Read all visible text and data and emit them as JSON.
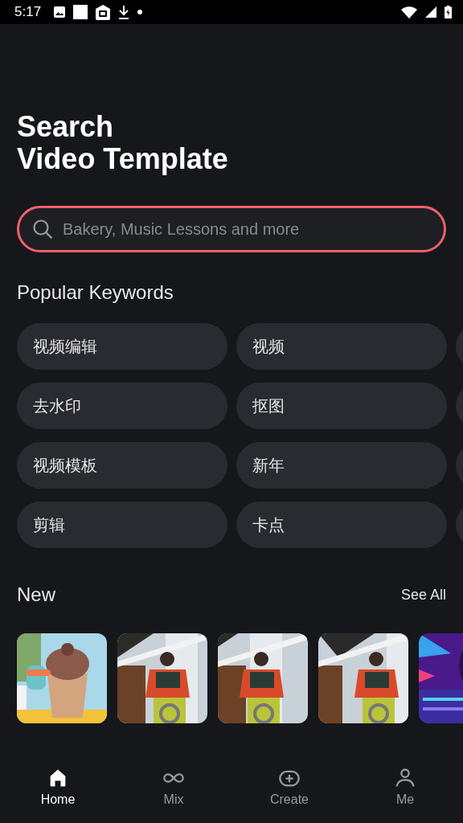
{
  "status_bar": {
    "time": "5:17"
  },
  "header": {
    "title_lines": [
      "Search",
      "Video Template"
    ]
  },
  "search": {
    "placeholder": "Bakery, Music Lessons and more"
  },
  "popular": {
    "title": "Popular Keywords",
    "keywords": [
      {
        "label": "视频编辑"
      },
      {
        "label": "视频"
      },
      {
        "label": "去水印"
      },
      {
        "label": "抠图"
      },
      {
        "label": "视频模板"
      },
      {
        "label": "新年"
      },
      {
        "label": "剪辑"
      },
      {
        "label": "卡点"
      }
    ]
  },
  "new_section": {
    "title": "New",
    "see_all": "See All"
  },
  "bottom_nav": [
    {
      "label": "Home",
      "kind": "home",
      "selected": true
    },
    {
      "label": "Mix",
      "kind": "mix",
      "selected": false
    },
    {
      "label": "Create",
      "kind": "create",
      "selected": false
    },
    {
      "label": "Me",
      "kind": "me",
      "selected": false
    }
  ]
}
